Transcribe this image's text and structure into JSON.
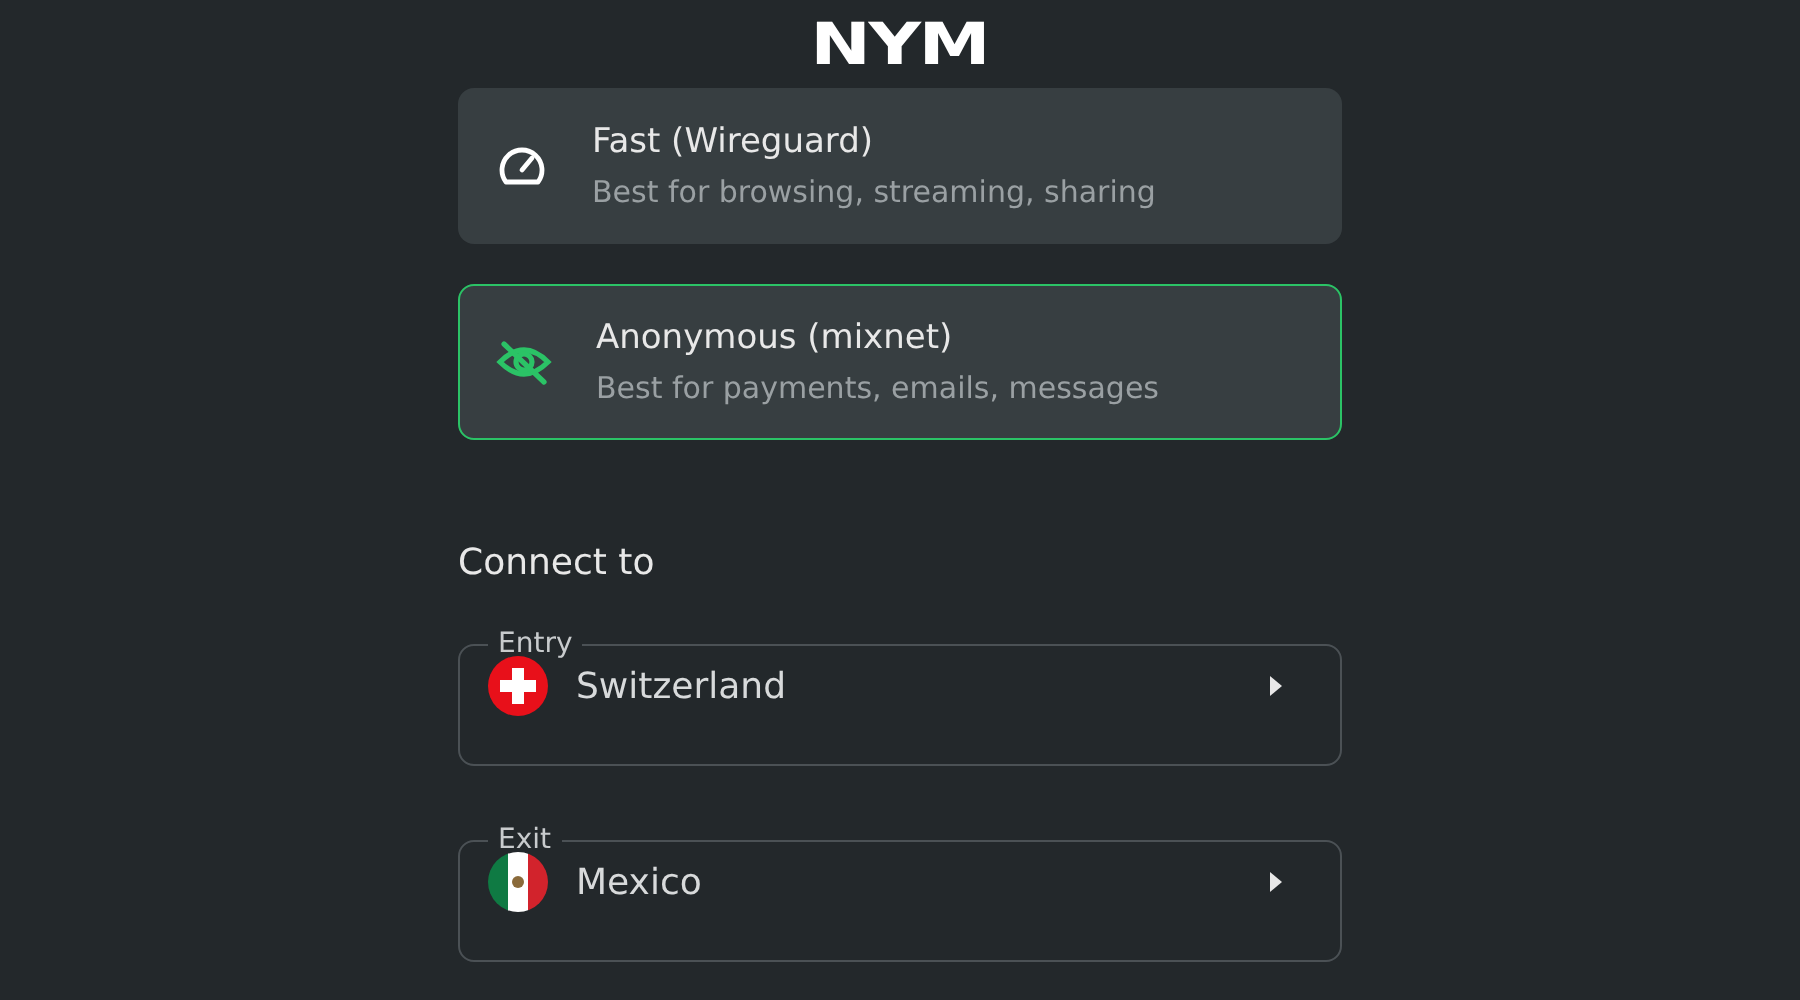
{
  "logo": "NYM",
  "modes": [
    {
      "kind": "speed",
      "title": "Fast (Wireguard)",
      "subtitle": "Best for browsing, streaming, sharing",
      "selected": false
    },
    {
      "kind": "hidden",
      "title": "Anonymous (mixnet)",
      "subtitle": "Best for payments, emails, messages",
      "selected": true
    }
  ],
  "connect_heading": "Connect to",
  "locations": [
    {
      "label": "Entry",
      "country": "Switzerland",
      "kind": "ch"
    },
    {
      "label": "Exit",
      "country": "Mexico",
      "kind": "mx"
    }
  ]
}
